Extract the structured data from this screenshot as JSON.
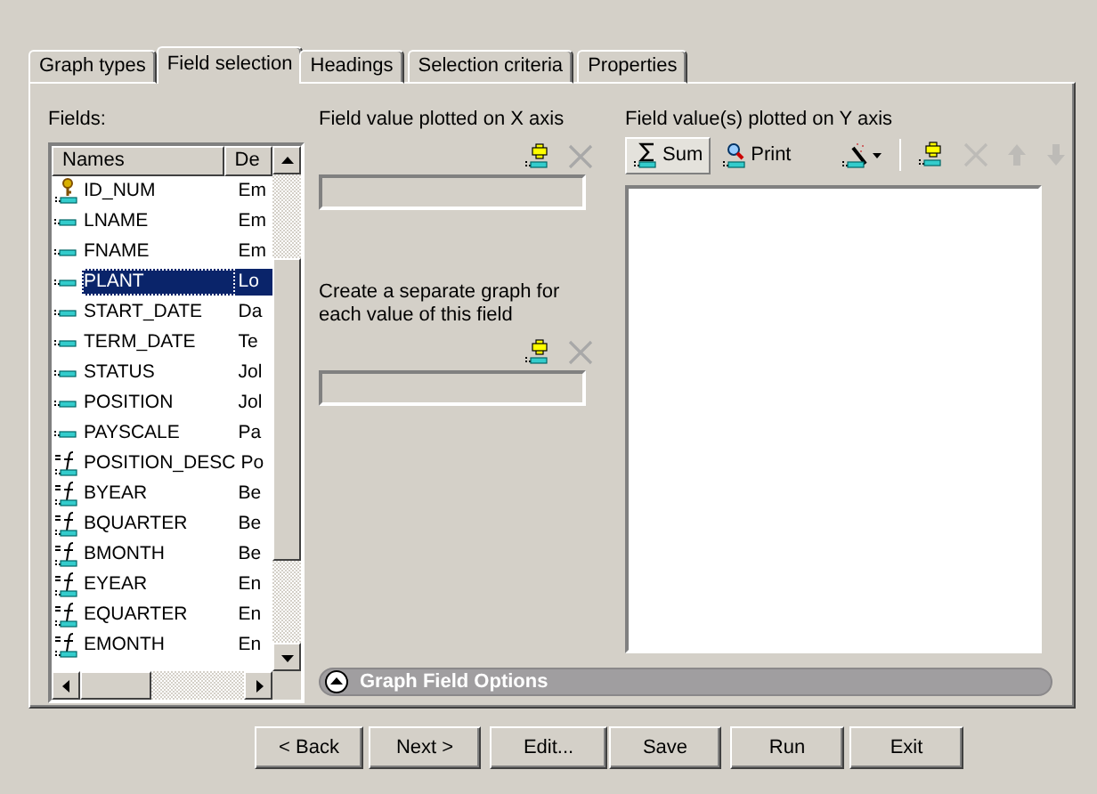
{
  "tabs": [
    {
      "label": "Graph types",
      "selected": false
    },
    {
      "label": "Field selection",
      "selected": true
    },
    {
      "label": "Headings",
      "selected": false
    },
    {
      "label": "Selection criteria",
      "selected": false
    },
    {
      "label": "Properties",
      "selected": false
    }
  ],
  "fields": {
    "label": "Fields:",
    "columns": [
      "Names",
      "De"
    ],
    "rows": [
      {
        "kind": "key",
        "name": "ID_NUM",
        "desc": "Em",
        "selected": false
      },
      {
        "kind": "field",
        "name": "LNAME",
        "desc": "Em",
        "selected": false
      },
      {
        "kind": "field",
        "name": "FNAME",
        "desc": "Em",
        "selected": false
      },
      {
        "kind": "field",
        "name": "PLANT",
        "desc": "Lo",
        "selected": true
      },
      {
        "kind": "field",
        "name": "START_DATE",
        "desc": "Da",
        "selected": false
      },
      {
        "kind": "field",
        "name": "TERM_DATE",
        "desc": "Te",
        "selected": false
      },
      {
        "kind": "field",
        "name": "STATUS",
        "desc": "Jol",
        "selected": false
      },
      {
        "kind": "field",
        "name": "POSITION",
        "desc": "Jol",
        "selected": false
      },
      {
        "kind": "field",
        "name": "PAYSCALE",
        "desc": "Pa",
        "selected": false
      },
      {
        "kind": "compute",
        "name": "POSITION_DESC",
        "desc": "Po",
        "selected": false
      },
      {
        "kind": "compute",
        "name": "BYEAR",
        "desc": "Be",
        "selected": false
      },
      {
        "kind": "compute",
        "name": "BQUARTER",
        "desc": "Be",
        "selected": false
      },
      {
        "kind": "compute",
        "name": "BMONTH",
        "desc": "Be",
        "selected": false
      },
      {
        "kind": "compute",
        "name": "EYEAR",
        "desc": "En",
        "selected": false
      },
      {
        "kind": "compute",
        "name": "EQUARTER",
        "desc": "En",
        "selected": false
      },
      {
        "kind": "compute",
        "name": "EMONTH",
        "desc": "En",
        "selected": false
      }
    ]
  },
  "x_axis": {
    "label": "Field value plotted on X axis",
    "add_disabled": false,
    "remove_disabled": true
  },
  "by_field": {
    "label": "Create a separate graph for each value of this field",
    "add_disabled": false,
    "remove_disabled": true
  },
  "y_axis": {
    "label": "Field value(s) plotted on Y axis",
    "toolbar": [
      {
        "kind": "sum",
        "label": "Sum",
        "selected": true,
        "disabled": false
      },
      {
        "kind": "print",
        "label": "Print",
        "selected": false,
        "disabled": false
      },
      {
        "kind": "wand",
        "selected": false,
        "disabled": false
      },
      {
        "kind": "separator"
      },
      {
        "kind": "add",
        "selected": false,
        "disabled": false
      },
      {
        "kind": "remove",
        "selected": false,
        "disabled": true
      },
      {
        "kind": "up",
        "selected": false,
        "disabled": true
      },
      {
        "kind": "down",
        "selected": false,
        "disabled": true
      }
    ]
  },
  "options_bar": {
    "label": "Graph Field Options",
    "expanded": false
  },
  "buttons": [
    {
      "label": "< Back",
      "kind": "back"
    },
    {
      "label": "Next >",
      "kind": "next"
    },
    {
      "label": "Edit...",
      "kind": "edit"
    },
    {
      "label": "Save",
      "kind": "save"
    },
    {
      "label": "Run",
      "kind": "run"
    },
    {
      "label": "Exit",
      "kind": "exit"
    }
  ]
}
